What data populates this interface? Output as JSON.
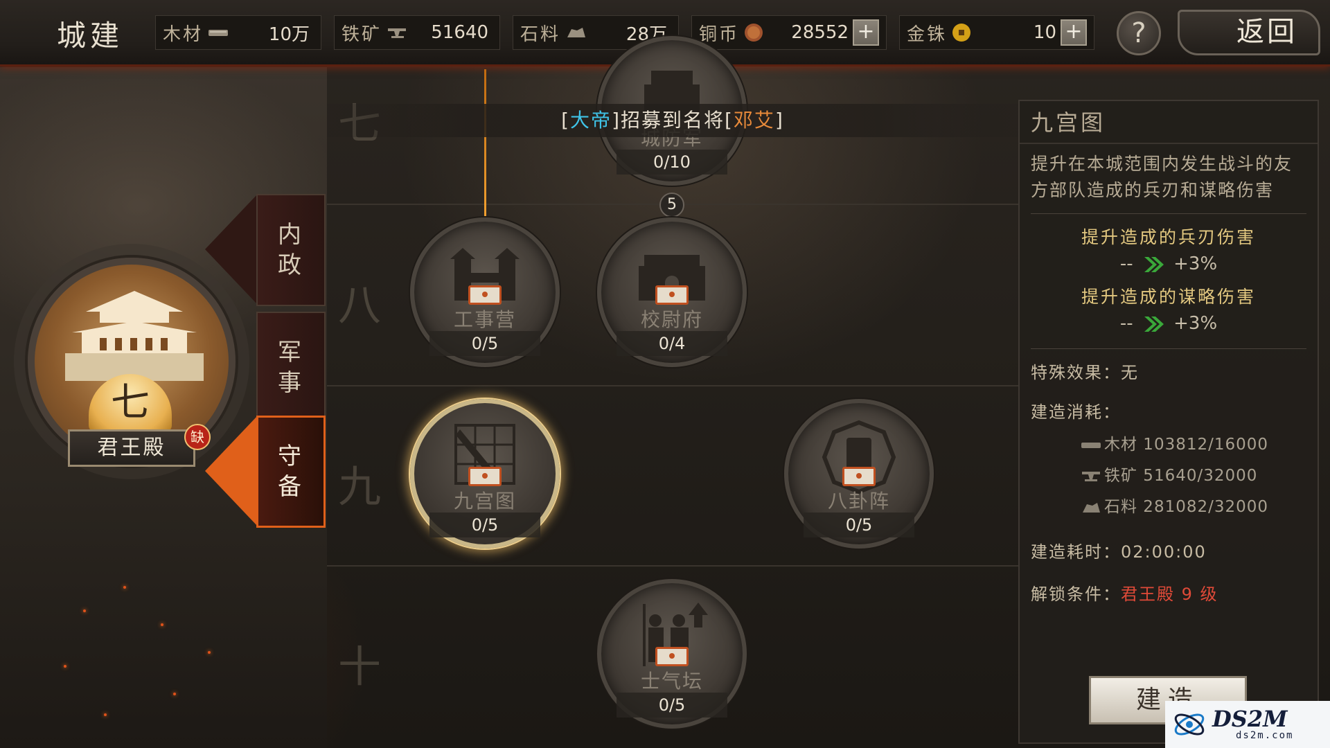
{
  "topbar": {
    "title": "城建",
    "resources": [
      {
        "name": "木材",
        "icon": "wood-icon",
        "value": "10万",
        "has_plus": false
      },
      {
        "name": "铁矿",
        "icon": "iron-icon",
        "value": "51640",
        "has_plus": false
      },
      {
        "name": "石料",
        "icon": "stone-icon",
        "value": "28万",
        "has_plus": false
      },
      {
        "name": "铜币",
        "icon": "copper-coin-icon",
        "value": "28552",
        "has_plus": true
      },
      {
        "name": "金铢",
        "icon": "gold-coin-icon",
        "value": "10",
        "has_plus": true
      }
    ],
    "help": "?",
    "back_label": "返回"
  },
  "notice": {
    "prefix": "[",
    "player": "大帝",
    "middle": "]招募到名将[",
    "general": "邓艾",
    "suffix": "]"
  },
  "rows": [
    "七",
    "八",
    "九",
    "十"
  ],
  "buildings": [
    {
      "id": "wall-guard",
      "name": "城防军",
      "count": "0/10"
    },
    {
      "id": "engineer-camp",
      "name": "工事营",
      "count": "0/5"
    },
    {
      "id": "captain-mansion",
      "name": "校尉府",
      "count": "0/4"
    },
    {
      "id": "nine-palace",
      "name": "九宫图",
      "count": "0/5",
      "selected": true
    },
    {
      "id": "eight-trigrams",
      "name": "八卦阵",
      "count": "0/5"
    },
    {
      "id": "morale-altar",
      "name": "士气坛",
      "count": "0/5"
    }
  ],
  "badge_value": "5",
  "palace": {
    "level": "七",
    "name": "君王殿",
    "lack": "缺"
  },
  "tabs": [
    {
      "label": [
        "内",
        "政"
      ],
      "active": false
    },
    {
      "label": [
        "军",
        "事"
      ],
      "active": false
    },
    {
      "label": [
        "守",
        "备"
      ],
      "active": true
    }
  ],
  "panel": {
    "title": "九宫图",
    "description": "提升在本城范围内发生战斗的友方部队造成的兵刃和谋略伤害",
    "effects": [
      {
        "title": "提升造成的兵刃伤害",
        "from": "--",
        "to": "+3%"
      },
      {
        "title": "提升造成的谋略伤害",
        "from": "--",
        "to": "+3%"
      }
    ],
    "special": "特殊效果：无",
    "cost_label": "建造消耗：",
    "costs": [
      {
        "icon": "wood-icon",
        "text": "木材 103812/16000"
      },
      {
        "icon": "iron-icon",
        "text": "铁矿 51640/32000"
      },
      {
        "icon": "stone-icon",
        "text": "石料 281082/32000"
      }
    ],
    "time_label": "建造耗时：",
    "time_value": "02:00:00",
    "unlock_label": "解锁条件：",
    "unlock_value": "君王殿 9 级",
    "build_label": "建造"
  },
  "watermark": {
    "brand": "DS2M",
    "site": "ds2m.com"
  },
  "colors": {
    "accent_orange": "#e0601a",
    "highlight_gold": "#e3c880",
    "cyan": "#3fc4e8",
    "red": "#e04a38"
  }
}
